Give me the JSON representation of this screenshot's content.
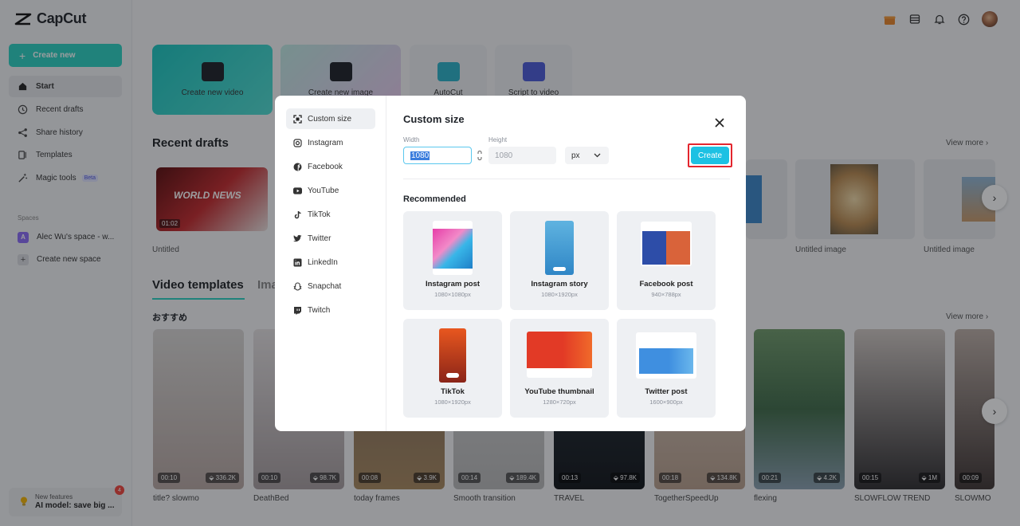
{
  "app": {
    "name": "CapCut"
  },
  "sidebar": {
    "create_new": "Create new",
    "items": [
      {
        "label": "Start"
      },
      {
        "label": "Recent drafts"
      },
      {
        "label": "Share history"
      },
      {
        "label": "Templates"
      },
      {
        "label": "Magic tools",
        "badge": "Beta"
      }
    ],
    "spaces_heading": "Spaces",
    "workspace": {
      "initial": "A",
      "name": "Alec Wu's space - w..."
    },
    "create_space": "Create new space",
    "new_features": {
      "title": "New features",
      "text": "AI model: save big ...",
      "count": "4"
    }
  },
  "main": {
    "tiles": [
      {
        "label": "Create new video"
      },
      {
        "label": "Create new image"
      },
      {
        "label": "AutoCut"
      },
      {
        "label": "Script to video"
      }
    ],
    "recent_drafts": {
      "title": "Recent drafts",
      "view_more": "View more",
      "items": [
        {
          "name": "Untitled",
          "thumb_text": "WORLD NEWS",
          "duration": "01:02"
        },
        {
          "name": "Untitled image"
        },
        {
          "name": "Untitled image"
        }
      ]
    },
    "video_templates": {
      "tab_active": "Video templates",
      "tab_other": "Ima",
      "subheading": "おすすめ",
      "view_more": "View more",
      "items": [
        {
          "name": "title? slowmo",
          "duration": "00:10",
          "uses": "336.2K"
        },
        {
          "name": "DeathBed",
          "duration": "00:10",
          "uses": "98.7K"
        },
        {
          "name": "today frames",
          "duration": "00:08",
          "uses": "3.9K"
        },
        {
          "name": "Smooth transition",
          "duration": "00:14",
          "uses": "189.4K"
        },
        {
          "name": "TRAVEL",
          "duration": "00:13",
          "uses": "97.8K"
        },
        {
          "name": "TogetherSpeedUp",
          "duration": "00:18",
          "uses": "134.8K"
        },
        {
          "name": "flexing",
          "duration": "00:21",
          "uses": "4.2K"
        },
        {
          "name": "SLOWFLOW TREND",
          "duration": "00:15",
          "uses": "1M"
        },
        {
          "name": "SLOWMO",
          "duration": "00:09",
          "uses": ""
        }
      ]
    }
  },
  "modal": {
    "title": "Custom size",
    "menu": [
      {
        "label": "Custom size"
      },
      {
        "label": "Instagram"
      },
      {
        "label": "Facebook"
      },
      {
        "label": "YouTube"
      },
      {
        "label": "TikTok"
      },
      {
        "label": "Twitter"
      },
      {
        "label": "LinkedIn"
      },
      {
        "label": "Snapchat"
      },
      {
        "label": "Twitch"
      }
    ],
    "width_label": "Width",
    "width_value": "1080",
    "height_label": "Height",
    "height_value": "1080",
    "unit": "px",
    "create_label": "Create",
    "recommended_heading": "Recommended",
    "presets": [
      {
        "name": "Instagram post",
        "size": "1080×1080px"
      },
      {
        "name": "Instagram story",
        "size": "1080×1920px"
      },
      {
        "name": "Facebook post",
        "size": "940×788px"
      },
      {
        "name": "TikTok",
        "size": "1080×1920px"
      },
      {
        "name": "YouTube thumbnail",
        "size": "1280×720px"
      },
      {
        "name": "Twitter post",
        "size": "1600×900px"
      }
    ]
  },
  "colors": {
    "accent": "#2ad1c1",
    "create_button": "#1dc1e3",
    "highlight_border": "#e3262e"
  }
}
